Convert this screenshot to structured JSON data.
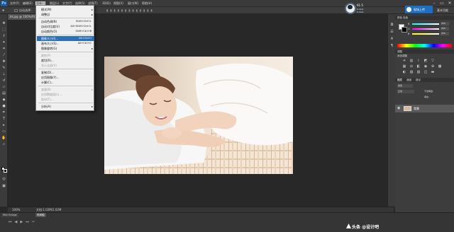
{
  "app": {
    "logo": "Ps",
    "window_controls": [
      "–",
      "▭",
      "✕"
    ]
  },
  "menubar": {
    "items": [
      "文件(F)",
      "编辑(E)",
      "图像(I)",
      "图层(L)",
      "文字(Y)",
      "选择(S)",
      "滤镜(T)",
      "3D(D)",
      "视图(V)",
      "窗口(W)",
      "帮助(H)"
    ]
  },
  "options": {
    "auto_select_label": "自动选择：",
    "speed_value": "61.5",
    "speed_up": "0.1K/s",
    "speed_down": "0.1K/s",
    "upload_label": "现场上传",
    "basic_function": "基本功能"
  },
  "document": {
    "tab_label": "3d.jpg @ 100%(RGB/8#)",
    "zoom": "100%",
    "size": "文档:1.02M/1.02M"
  },
  "timeline": {
    "tab1": "Mini Bridge",
    "tab2": "时间轴"
  },
  "image_menu": {
    "items": [
      {
        "label": "模式(M)",
        "shortcut": "",
        "submenu": true,
        "disabled": false,
        "highlighted": false
      },
      {
        "label": "调整(J)",
        "shortcut": "",
        "submenu": true,
        "disabled": false,
        "highlighted": false
      },
      {
        "label": "自动色调(N)",
        "shortcut": "Shift+Ctrl+L",
        "submenu": false,
        "disabled": false,
        "highlighted": false
      },
      {
        "label": "自动对比度(U)",
        "shortcut": "Alt+Shift+Ctrl+L",
        "submenu": false,
        "disabled": false,
        "highlighted": false
      },
      {
        "label": "自动颜色(O)",
        "shortcut": "Shift+Ctrl+B",
        "submenu": false,
        "disabled": false,
        "highlighted": false
      },
      {
        "label": "图像大小(I)...",
        "shortcut": "Alt+Ctrl+I",
        "submenu": false,
        "disabled": false,
        "highlighted": true
      },
      {
        "label": "画布大小(S)...",
        "shortcut": "Alt+Ctrl+C",
        "submenu": false,
        "disabled": false,
        "highlighted": false
      },
      {
        "label": "图像旋转(G)",
        "shortcut": "",
        "submenu": true,
        "disabled": false,
        "highlighted": false
      },
      {
        "label": "裁剪(P)",
        "shortcut": "",
        "submenu": false,
        "disabled": true,
        "highlighted": false
      },
      {
        "label": "裁切(R)...",
        "shortcut": "",
        "submenu": false,
        "disabled": false,
        "highlighted": false
      },
      {
        "label": "显示全部(V)",
        "shortcut": "",
        "submenu": false,
        "disabled": true,
        "highlighted": false
      },
      {
        "label": "复制(D)...",
        "shortcut": "",
        "submenu": false,
        "disabled": false,
        "highlighted": false
      },
      {
        "label": "应用图像(Y)...",
        "shortcut": "",
        "submenu": false,
        "disabled": false,
        "highlighted": false
      },
      {
        "label": "计算(C)...",
        "shortcut": "",
        "submenu": false,
        "disabled": false,
        "highlighted": false
      },
      {
        "label": "变量(B)",
        "shortcut": "",
        "submenu": true,
        "disabled": true,
        "highlighted": false
      },
      {
        "label": "应用数据组(L)...",
        "shortcut": "",
        "submenu": false,
        "disabled": true,
        "highlighted": false
      },
      {
        "label": "陷印(T)...",
        "shortcut": "",
        "submenu": false,
        "disabled": true,
        "highlighted": false
      },
      {
        "label": "分析(A)",
        "shortcut": "",
        "submenu": true,
        "disabled": false,
        "highlighted": false
      }
    ]
  },
  "color_panel": {
    "r_label": "R",
    "r_value": "255",
    "g_label": "G",
    "g_value": "255",
    "b_label": "B",
    "b_value": "255"
  },
  "adjust_panel": {
    "tab": "调整",
    "title": "添加调整"
  },
  "layers_panel": {
    "tabs": [
      "图层",
      "通道",
      "路径"
    ],
    "kind": "类型",
    "blend_mode": "正常",
    "opacity_label": "不透明度:",
    "fill_label": "填充:",
    "layer_name": "背景"
  },
  "watermark": {
    "text": "头条 @设计吧"
  },
  "colors": {
    "menu_highlight": "#2d6fb7",
    "upload_button": "#1f6fc1"
  }
}
